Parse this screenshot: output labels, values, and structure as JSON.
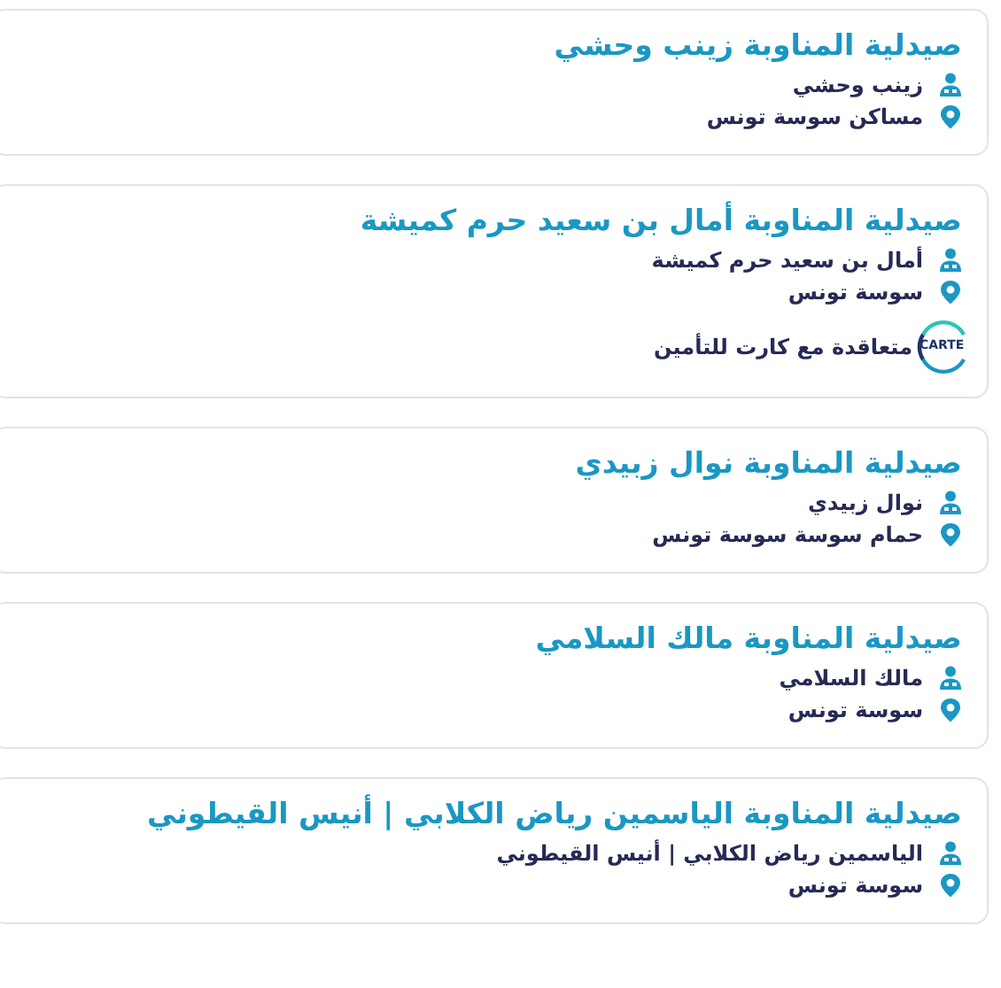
{
  "pharmacies": [
    {
      "title": "صيدلية المناوبة زينب وحشي",
      "owner": "زينب وحشي",
      "address": "مساكن سوسة تونس"
    },
    {
      "title": "صيدلية المناوبة أمال بن سعيد حرم كميشة",
      "owner": "أمال بن سعيد حرم كميشة",
      "address": "سوسة تونس",
      "insurance": {
        "logo_text": "CARTE",
        "label": "متعاقدة مع كارت للتأمين"
      }
    },
    {
      "title": "صيدلية المناوبة نوال زبيدي",
      "owner": "نوال زبيدي",
      "address": "حمام سوسة سوسة تونس"
    },
    {
      "title": "صيدلية المناوبة مالك السلامي",
      "owner": "مالك السلامي",
      "address": "سوسة تونس"
    },
    {
      "title": "صيدلية المناوبة الياسمين رياض الكلابي | أنيس القيطوني",
      "owner": "الياسمين رياض الكلابي | أنيس القيطوني",
      "address": "سوسة تونس"
    }
  ]
}
